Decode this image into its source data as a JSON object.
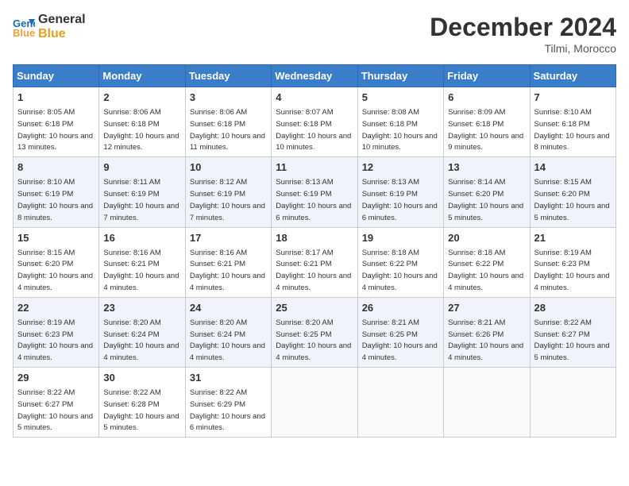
{
  "header": {
    "logo_line1": "General",
    "logo_line2": "Blue",
    "month_title": "December 2024",
    "location": "Tilmi, Morocco"
  },
  "weekdays": [
    "Sunday",
    "Monday",
    "Tuesday",
    "Wednesday",
    "Thursday",
    "Friday",
    "Saturday"
  ],
  "weeks": [
    [
      {
        "day": "1",
        "sunrise": "Sunrise: 8:05 AM",
        "sunset": "Sunset: 6:18 PM",
        "daylight": "Daylight: 10 hours and 13 minutes."
      },
      {
        "day": "2",
        "sunrise": "Sunrise: 8:06 AM",
        "sunset": "Sunset: 6:18 PM",
        "daylight": "Daylight: 10 hours and 12 minutes."
      },
      {
        "day": "3",
        "sunrise": "Sunrise: 8:06 AM",
        "sunset": "Sunset: 6:18 PM",
        "daylight": "Daylight: 10 hours and 11 minutes."
      },
      {
        "day": "4",
        "sunrise": "Sunrise: 8:07 AM",
        "sunset": "Sunset: 6:18 PM",
        "daylight": "Daylight: 10 hours and 10 minutes."
      },
      {
        "day": "5",
        "sunrise": "Sunrise: 8:08 AM",
        "sunset": "Sunset: 6:18 PM",
        "daylight": "Daylight: 10 hours and 10 minutes."
      },
      {
        "day": "6",
        "sunrise": "Sunrise: 8:09 AM",
        "sunset": "Sunset: 6:18 PM",
        "daylight": "Daylight: 10 hours and 9 minutes."
      },
      {
        "day": "7",
        "sunrise": "Sunrise: 8:10 AM",
        "sunset": "Sunset: 6:18 PM",
        "daylight": "Daylight: 10 hours and 8 minutes."
      }
    ],
    [
      {
        "day": "8",
        "sunrise": "Sunrise: 8:10 AM",
        "sunset": "Sunset: 6:19 PM",
        "daylight": "Daylight: 10 hours and 8 minutes."
      },
      {
        "day": "9",
        "sunrise": "Sunrise: 8:11 AM",
        "sunset": "Sunset: 6:19 PM",
        "daylight": "Daylight: 10 hours and 7 minutes."
      },
      {
        "day": "10",
        "sunrise": "Sunrise: 8:12 AM",
        "sunset": "Sunset: 6:19 PM",
        "daylight": "Daylight: 10 hours and 7 minutes."
      },
      {
        "day": "11",
        "sunrise": "Sunrise: 8:13 AM",
        "sunset": "Sunset: 6:19 PM",
        "daylight": "Daylight: 10 hours and 6 minutes."
      },
      {
        "day": "12",
        "sunrise": "Sunrise: 8:13 AM",
        "sunset": "Sunset: 6:19 PM",
        "daylight": "Daylight: 10 hours and 6 minutes."
      },
      {
        "day": "13",
        "sunrise": "Sunrise: 8:14 AM",
        "sunset": "Sunset: 6:20 PM",
        "daylight": "Daylight: 10 hours and 5 minutes."
      },
      {
        "day": "14",
        "sunrise": "Sunrise: 8:15 AM",
        "sunset": "Sunset: 6:20 PM",
        "daylight": "Daylight: 10 hours and 5 minutes."
      }
    ],
    [
      {
        "day": "15",
        "sunrise": "Sunrise: 8:15 AM",
        "sunset": "Sunset: 6:20 PM",
        "daylight": "Daylight: 10 hours and 4 minutes."
      },
      {
        "day": "16",
        "sunrise": "Sunrise: 8:16 AM",
        "sunset": "Sunset: 6:21 PM",
        "daylight": "Daylight: 10 hours and 4 minutes."
      },
      {
        "day": "17",
        "sunrise": "Sunrise: 8:16 AM",
        "sunset": "Sunset: 6:21 PM",
        "daylight": "Daylight: 10 hours and 4 minutes."
      },
      {
        "day": "18",
        "sunrise": "Sunrise: 8:17 AM",
        "sunset": "Sunset: 6:21 PM",
        "daylight": "Daylight: 10 hours and 4 minutes."
      },
      {
        "day": "19",
        "sunrise": "Sunrise: 8:18 AM",
        "sunset": "Sunset: 6:22 PM",
        "daylight": "Daylight: 10 hours and 4 minutes."
      },
      {
        "day": "20",
        "sunrise": "Sunrise: 8:18 AM",
        "sunset": "Sunset: 6:22 PM",
        "daylight": "Daylight: 10 hours and 4 minutes."
      },
      {
        "day": "21",
        "sunrise": "Sunrise: 8:19 AM",
        "sunset": "Sunset: 6:23 PM",
        "daylight": "Daylight: 10 hours and 4 minutes."
      }
    ],
    [
      {
        "day": "22",
        "sunrise": "Sunrise: 8:19 AM",
        "sunset": "Sunset: 6:23 PM",
        "daylight": "Daylight: 10 hours and 4 minutes."
      },
      {
        "day": "23",
        "sunrise": "Sunrise: 8:20 AM",
        "sunset": "Sunset: 6:24 PM",
        "daylight": "Daylight: 10 hours and 4 minutes."
      },
      {
        "day": "24",
        "sunrise": "Sunrise: 8:20 AM",
        "sunset": "Sunset: 6:24 PM",
        "daylight": "Daylight: 10 hours and 4 minutes."
      },
      {
        "day": "25",
        "sunrise": "Sunrise: 8:20 AM",
        "sunset": "Sunset: 6:25 PM",
        "daylight": "Daylight: 10 hours and 4 minutes."
      },
      {
        "day": "26",
        "sunrise": "Sunrise: 8:21 AM",
        "sunset": "Sunset: 6:25 PM",
        "daylight": "Daylight: 10 hours and 4 minutes."
      },
      {
        "day": "27",
        "sunrise": "Sunrise: 8:21 AM",
        "sunset": "Sunset: 6:26 PM",
        "daylight": "Daylight: 10 hours and 4 minutes."
      },
      {
        "day": "28",
        "sunrise": "Sunrise: 8:22 AM",
        "sunset": "Sunset: 6:27 PM",
        "daylight": "Daylight: 10 hours and 5 minutes."
      }
    ],
    [
      {
        "day": "29",
        "sunrise": "Sunrise: 8:22 AM",
        "sunset": "Sunset: 6:27 PM",
        "daylight": "Daylight: 10 hours and 5 minutes."
      },
      {
        "day": "30",
        "sunrise": "Sunrise: 8:22 AM",
        "sunset": "Sunset: 6:28 PM",
        "daylight": "Daylight: 10 hours and 5 minutes."
      },
      {
        "day": "31",
        "sunrise": "Sunrise: 8:22 AM",
        "sunset": "Sunset: 6:29 PM",
        "daylight": "Daylight: 10 hours and 6 minutes."
      },
      null,
      null,
      null,
      null
    ]
  ]
}
